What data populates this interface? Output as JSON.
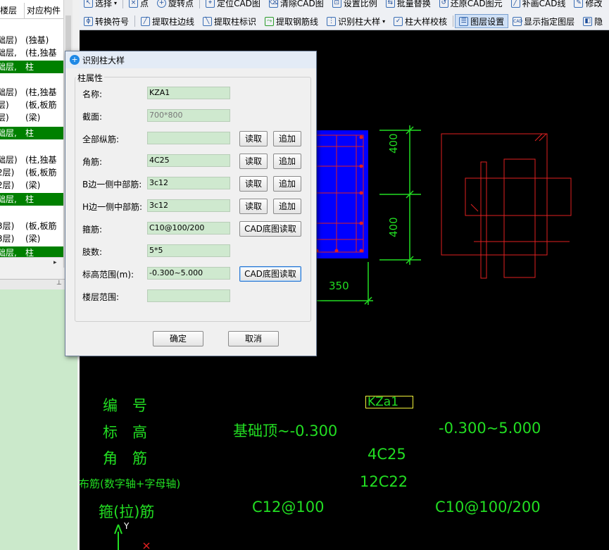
{
  "toolbar": {
    "row1": [
      "选择",
      "点",
      "旋转点",
      "定位CAD图",
      "清除CAD图",
      "设置比例",
      "批量替换",
      "还原CAD图元",
      "补画CAD线",
      "修改"
    ],
    "row2": [
      "转换符号",
      "提取柱边线",
      "提取柱标识",
      "提取钢筋线",
      "识别柱大样",
      "柱大样校核",
      "图层设置",
      "显示指定图层",
      "隐"
    ]
  },
  "left_panel": {
    "headers": [
      "楼层",
      "对应构件"
    ],
    "rows": [
      {
        "a": "础层)",
        "b": "(独基)",
        "green": false
      },
      {
        "a": "础层,",
        "b": "(柱,独基",
        "green": false
      },
      {
        "a": "础层,",
        "b": "柱",
        "green": true
      },
      {
        "a": "础层)",
        "b": "(柱,独基",
        "green": false
      },
      {
        "a": "层)",
        "b": "(板,板筋",
        "green": false
      },
      {
        "a": "层)",
        "b": "(梁)",
        "green": false
      },
      {
        "a": "础层,",
        "b": "柱",
        "green": true
      },
      {
        "a": "础层)",
        "b": "(柱,独基",
        "green": false
      },
      {
        "a": "2层)",
        "b": "(板,板筋",
        "green": false
      },
      {
        "a": "2层)",
        "b": "(梁)",
        "green": false
      },
      {
        "a": "础层,",
        "b": "柱",
        "green": true
      },
      {
        "a": "3层)",
        "b": "(板,板筋",
        "green": false
      },
      {
        "a": "3层)",
        "b": "(梁)",
        "green": false
      },
      {
        "a": "础层,",
        "b": "柱",
        "green": true
      }
    ]
  },
  "dialog": {
    "title": "识别柱大样",
    "group_title": "柱属性",
    "fields": {
      "name": {
        "label": "名称:",
        "value": "KZA1"
      },
      "section": {
        "label": "截面:",
        "value": "700*800"
      },
      "all_rebar": {
        "label": "全部纵筋:",
        "value": ""
      },
      "corner": {
        "label": "角筋:",
        "value": "4C25"
      },
      "b_side": {
        "label": "B边一侧中部筋:",
        "value": "3c12"
      },
      "h_side": {
        "label": "H边一侧中部筋:",
        "value": "3c12"
      },
      "stirrup": {
        "label": "箍筋:",
        "value": "C10@100/200"
      },
      "legs": {
        "label": "肢数:",
        "value": "5*5"
      },
      "elevation": {
        "label": "标高范围(m):",
        "value": "-0.300~5.000"
      },
      "floor": {
        "label": "楼层范围:",
        "value": ""
      }
    },
    "buttons": {
      "read": "读取",
      "append": "追加",
      "cad_read": "CAD底图读取",
      "ok": "确定",
      "cancel": "取消"
    }
  },
  "canvas": {
    "dims": {
      "d1": "400",
      "d2": "400",
      "d3": "350"
    },
    "table": {
      "label_code": "编　号",
      "label_elev": "标　高",
      "label_corner": "角　筋",
      "label_mid": "布筋(数字轴+字母轴)",
      "label_stirrup": "箍(拉)筋",
      "code_value": "KZa1",
      "elev1": "基础顶~-0.300",
      "elev2": "-0.300~5.000",
      "corner_value": "4C25",
      "mid_value": "12C22",
      "stirrup1": "C12@100",
      "stirrup2": "C10@100/200"
    },
    "axis_y": "Y"
  },
  "colors": {
    "cad_green": "#22dd22",
    "cad_red": "#e02020",
    "column_blue": "#0000ff",
    "highlight_green": "#008000"
  }
}
